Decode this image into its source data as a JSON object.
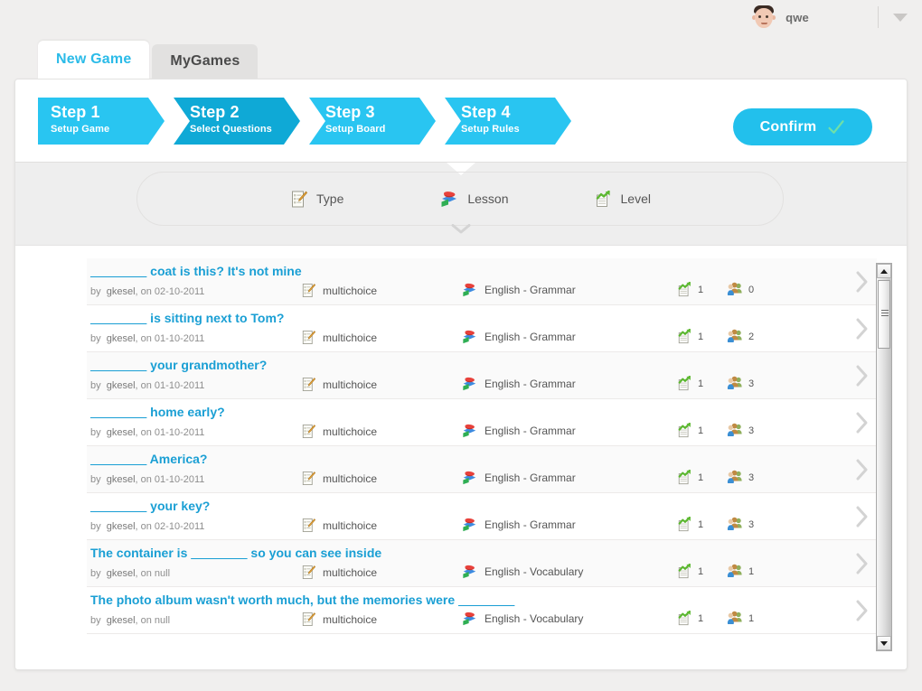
{
  "header": {
    "username": "qwe",
    "avatar_icon": "user-avatar-face",
    "caret_icon": "chevron-down-icon"
  },
  "tabs": [
    {
      "label": "New Game",
      "active": true
    },
    {
      "label": "MyGames",
      "active": false
    }
  ],
  "wizard": {
    "steps": [
      {
        "title": "Step 1",
        "subtitle": "Setup Game",
        "active": false
      },
      {
        "title": "Step 2",
        "subtitle": "Select Questions",
        "active": true
      },
      {
        "title": "Step 3",
        "subtitle": "Setup Board",
        "active": false
      },
      {
        "title": "Step 4",
        "subtitle": "Setup Rules",
        "active": false
      }
    ],
    "confirm_label": "Confirm",
    "confirm_icon": "check-icon",
    "active_color": "#0fa9d6",
    "step_color": "#29c5f1",
    "confirm_color": "#22c0ec"
  },
  "filters": [
    {
      "label": "Type",
      "icon": "clipboard-pencil-icon"
    },
    {
      "label": "Lesson",
      "icon": "books-icon"
    },
    {
      "label": "Level",
      "icon": "notepad-arrow-icon"
    }
  ],
  "filter_expand_icon": "chevron-down-icon",
  "questions": [
    {
      "blank": "________",
      "text": " coat is this? It's not mine",
      "blank_first": true,
      "author": "gkesel",
      "date": "02-10-2011",
      "by_prefix": "by",
      "on_prefix": "on",
      "type": "multichoice",
      "lesson": "English - Grammar",
      "level": "1",
      "users": "0"
    },
    {
      "blank": "________",
      "text": " is sitting next to Tom?",
      "blank_first": true,
      "author": "gkesel",
      "date": "01-10-2011",
      "by_prefix": "by",
      "on_prefix": "on",
      "type": "multichoice",
      "lesson": "English - Grammar",
      "level": "1",
      "users": "2"
    },
    {
      "blank": "________",
      "text": " your grandmother?",
      "blank_first": true,
      "author": "gkesel",
      "date": "01-10-2011",
      "by_prefix": "by",
      "on_prefix": "on",
      "type": "multichoice",
      "lesson": "English - Grammar",
      "level": "1",
      "users": "3"
    },
    {
      "blank": "________",
      "text": " home early?",
      "blank_first": true,
      "author": "gkesel",
      "date": "01-10-2011",
      "by_prefix": "by",
      "on_prefix": "on",
      "type": "multichoice",
      "lesson": "English - Grammar",
      "level": "1",
      "users": "3"
    },
    {
      "blank": "________",
      "text": " America?",
      "blank_first": true,
      "author": "gkesel",
      "date": "01-10-2011",
      "by_prefix": "by",
      "on_prefix": "on",
      "type": "multichoice",
      "lesson": "English - Grammar",
      "level": "1",
      "users": "3"
    },
    {
      "blank": "________",
      "text": " your key?",
      "blank_first": true,
      "author": "gkesel",
      "date": "02-10-2011",
      "by_prefix": "by",
      "on_prefix": "on",
      "type": "multichoice",
      "lesson": "English - Grammar",
      "level": "1",
      "users": "3"
    },
    {
      "prefix": "The container is ",
      "blank": "________",
      "text": " so you can see inside",
      "blank_first": false,
      "author": "gkesel",
      "date": "null",
      "by_prefix": "by",
      "on_prefix": "on",
      "type": "multichoice",
      "lesson": "English - Vocabulary",
      "level": "1",
      "users": "1"
    },
    {
      "prefix": "The photo album wasn't worth much, but the memories were ",
      "blank": "________",
      "text": "",
      "blank_first": false,
      "author": "gkesel",
      "date": "null",
      "by_prefix": "by",
      "on_prefix": "on",
      "type": "multichoice",
      "lesson": "English - Vocabulary",
      "level": "1",
      "users": "1"
    }
  ],
  "row_arrow_icon": "chevron-right-icon",
  "scrollbar": {
    "up_icon": "triangle-up-icon",
    "down_icon": "triangle-down-icon",
    "thumb_name": "scrollbar-thumb"
  }
}
